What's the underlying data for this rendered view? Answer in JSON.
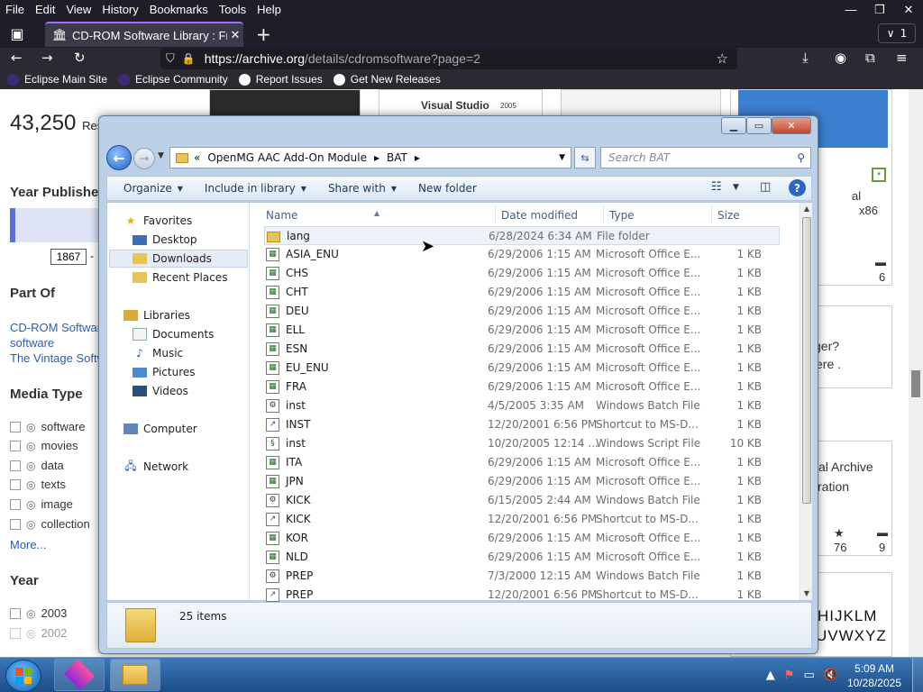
{
  "browser": {
    "menu": [
      "File",
      "Edit",
      "View",
      "History",
      "Bookmarks",
      "Tools",
      "Help"
    ],
    "window_controls": [
      "—",
      "❐",
      "✕"
    ],
    "tab": {
      "title": "CD-ROM Software Library : Free",
      "close": "✕"
    },
    "newtab": "+",
    "tab_count": "1",
    "url_host": "https://archive.org",
    "url_path": "/details/cdromsoftware?page=2",
    "bookmarks": [
      "Eclipse Main Site",
      "Eclipse Community",
      "Report Issues",
      "Get New Releases"
    ]
  },
  "page": {
    "results_count": "43,250",
    "results_suffix": "Res",
    "year_published": "Year Publishe",
    "year_from": "1867",
    "year_dash": "-",
    "part_of": "Part Of",
    "part_links": [
      "CD-ROM Software",
      "software",
      "The Vintage Softw"
    ],
    "media_type": "Media Type",
    "media_types": [
      "software",
      "movies",
      "data",
      "texts",
      "image",
      "collection"
    ],
    "more": "More...",
    "year_heading": "Year",
    "years": [
      "2003",
      "2002"
    ],
    "card_texts": {
      "vs": "Visual Studio",
      "vs_year": "2005",
      "al": "al",
      "x86": "x86",
      "c6": "6",
      "ger": "ger?",
      "ere": "ere .",
      "dig": "ital Archive",
      "ration": "ration",
      "c76": "76",
      "c9": "9",
      "hij": "HIJKLM",
      "uvw": "UVWXYZ"
    }
  },
  "explorer": {
    "breadcrumb": [
      "«",
      "OpenMG AAC Add-On Module",
      "▸",
      "BAT",
      "▸"
    ],
    "search_placeholder": "Search BAT",
    "toolbar": {
      "organize": "Organize",
      "include": "Include in library",
      "share": "Share with",
      "new_folder": "New folder"
    },
    "nav": {
      "favorites": "Favorites",
      "desktop": "Desktop",
      "downloads": "Downloads",
      "recent": "Recent Places",
      "libraries": "Libraries",
      "documents": "Documents",
      "music": "Music",
      "pictures": "Pictures",
      "videos": "Videos",
      "computer": "Computer",
      "network": "Network"
    },
    "columns": {
      "name": "Name",
      "date": "Date modified",
      "type": "Type",
      "size": "Size"
    },
    "files": [
      {
        "name": "lang",
        "date": "6/28/2024 6:34 AM",
        "type": "File folder",
        "size": "",
        "icon": "folder"
      },
      {
        "name": "ASIA_ENU",
        "date": "6/29/2006 1:15 AM",
        "type": "Microsoft Office E...",
        "size": "1 KB",
        "icon": "xls"
      },
      {
        "name": "CHS",
        "date": "6/29/2006 1:15 AM",
        "type": "Microsoft Office E...",
        "size": "1 KB",
        "icon": "xls"
      },
      {
        "name": "CHT",
        "date": "6/29/2006 1:15 AM",
        "type": "Microsoft Office E...",
        "size": "1 KB",
        "icon": "xls"
      },
      {
        "name": "DEU",
        "date": "6/29/2006 1:15 AM",
        "type": "Microsoft Office E...",
        "size": "1 KB",
        "icon": "xls"
      },
      {
        "name": "ELL",
        "date": "6/29/2006 1:15 AM",
        "type": "Microsoft Office E...",
        "size": "1 KB",
        "icon": "xls"
      },
      {
        "name": "ESN",
        "date": "6/29/2006 1:15 AM",
        "type": "Microsoft Office E...",
        "size": "1 KB",
        "icon": "xls"
      },
      {
        "name": "EU_ENU",
        "date": "6/29/2006 1:15 AM",
        "type": "Microsoft Office E...",
        "size": "1 KB",
        "icon": "xls"
      },
      {
        "name": "FRA",
        "date": "6/29/2006 1:15 AM",
        "type": "Microsoft Office E...",
        "size": "1 KB",
        "icon": "xls"
      },
      {
        "name": "inst",
        "date": "4/5/2005 3:35 AM",
        "type": "Windows Batch File",
        "size": "1 KB",
        "icon": "bat"
      },
      {
        "name": "INST",
        "date": "12/20/2001 6:56 PM",
        "type": "Shortcut to MS-D...",
        "size": "1 KB",
        "icon": "lnk"
      },
      {
        "name": "inst",
        "date": "10/20/2005 12:14 ...",
        "type": "Windows Script File",
        "size": "10 KB",
        "icon": "wsf"
      },
      {
        "name": "ITA",
        "date": "6/29/2006 1:15 AM",
        "type": "Microsoft Office E...",
        "size": "1 KB",
        "icon": "xls"
      },
      {
        "name": "JPN",
        "date": "6/29/2006 1:15 AM",
        "type": "Microsoft Office E...",
        "size": "1 KB",
        "icon": "xls"
      },
      {
        "name": "KICK",
        "date": "6/15/2005 2:44 AM",
        "type": "Windows Batch File",
        "size": "1 KB",
        "icon": "bat"
      },
      {
        "name": "KICK",
        "date": "12/20/2001 6:56 PM",
        "type": "Shortcut to MS-D...",
        "size": "1 KB",
        "icon": "lnk"
      },
      {
        "name": "KOR",
        "date": "6/29/2006 1:15 AM",
        "type": "Microsoft Office E...",
        "size": "1 KB",
        "icon": "xls"
      },
      {
        "name": "NLD",
        "date": "6/29/2006 1:15 AM",
        "type": "Microsoft Office E...",
        "size": "1 KB",
        "icon": "xls"
      },
      {
        "name": "PREP",
        "date": "7/3/2000 12:15 AM",
        "type": "Windows Batch File",
        "size": "1 KB",
        "icon": "bat"
      },
      {
        "name": "PREP",
        "date": "12/20/2001 6:56 PM",
        "type": "Shortcut to MS-D...",
        "size": "1 KB",
        "icon": "lnk"
      }
    ],
    "item_count": "25 items"
  },
  "taskbar": {
    "time": "5:09 AM",
    "date": "10/28/2025",
    "tray_arrow": "▲"
  }
}
